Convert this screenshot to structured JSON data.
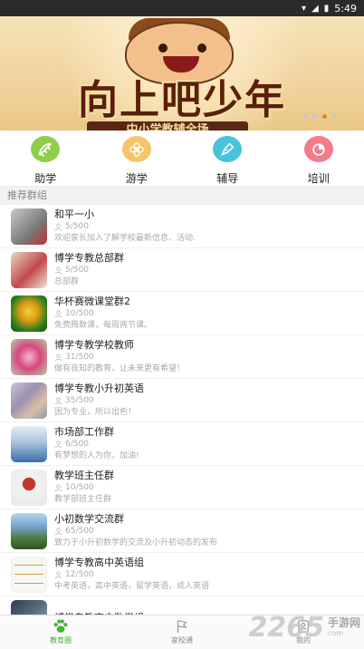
{
  "statusbar": {
    "time": "5:49",
    "signal_icon": "signal-icon",
    "wifi_icon": "wifi-icon",
    "battery_icon": "battery-icon"
  },
  "banner": {
    "heading": "向上吧少年",
    "subtitle": "中小学教辅全场",
    "page_count": 4,
    "active_page": 3
  },
  "quick_nav": [
    {
      "label": "助学",
      "icon": "ruler-icon",
      "color": "#8fcf4e"
    },
    {
      "label": "游学",
      "icon": "flower-icon",
      "color": "#f5c56a"
    },
    {
      "label": "辅导",
      "icon": "pen-icon",
      "color": "#49c3dc"
    },
    {
      "label": "培训",
      "icon": "pie-icon",
      "color": "#f27c8a"
    }
  ],
  "section": {
    "title": "推荐群组"
  },
  "groups": [
    {
      "name": "和平一小",
      "count": "5/500",
      "desc": "欢迎家长加入了解学校最新信息、活动."
    },
    {
      "name": "博学专教总部群",
      "count": "5/500",
      "desc": "总部群"
    },
    {
      "name": "华杯赛微课堂群2",
      "count": "10/500",
      "desc": "免费腾数课，每周两节课。"
    },
    {
      "name": "博学专教学校教师",
      "count": "31/500",
      "desc": "做有良知的教育，让未来更有希望！"
    },
    {
      "name": "博学专教小升初英语",
      "count": "35/500",
      "desc": "因为专业，所以出色！"
    },
    {
      "name": "市场部工作群",
      "count": "6/500",
      "desc": "有梦想的人为你，加油!"
    },
    {
      "name": "教学班主任群",
      "count": "10/500",
      "desc": "教学部班主任群"
    },
    {
      "name": "小初数学交流群",
      "count": "65/500",
      "desc": "致力于小升初数学的交流及小升初动态的发布"
    },
    {
      "name": "博学专教高中英语组",
      "count": "12/500",
      "desc": "中考英语，高中英语，留学英语，成人英语"
    },
    {
      "name": "博学专教高中数学组",
      "count": "",
      "desc": ""
    }
  ],
  "tabbar": [
    {
      "label": "教育圈",
      "icon": "paw-icon",
      "active": true
    },
    {
      "label": "家校通",
      "icon": "flag-icon",
      "active": false
    },
    {
      "label": "我的",
      "icon": "profile-icon",
      "active": false
    }
  ],
  "watermark": {
    "number": "2265",
    "cn": "手游网",
    "en": "com"
  }
}
